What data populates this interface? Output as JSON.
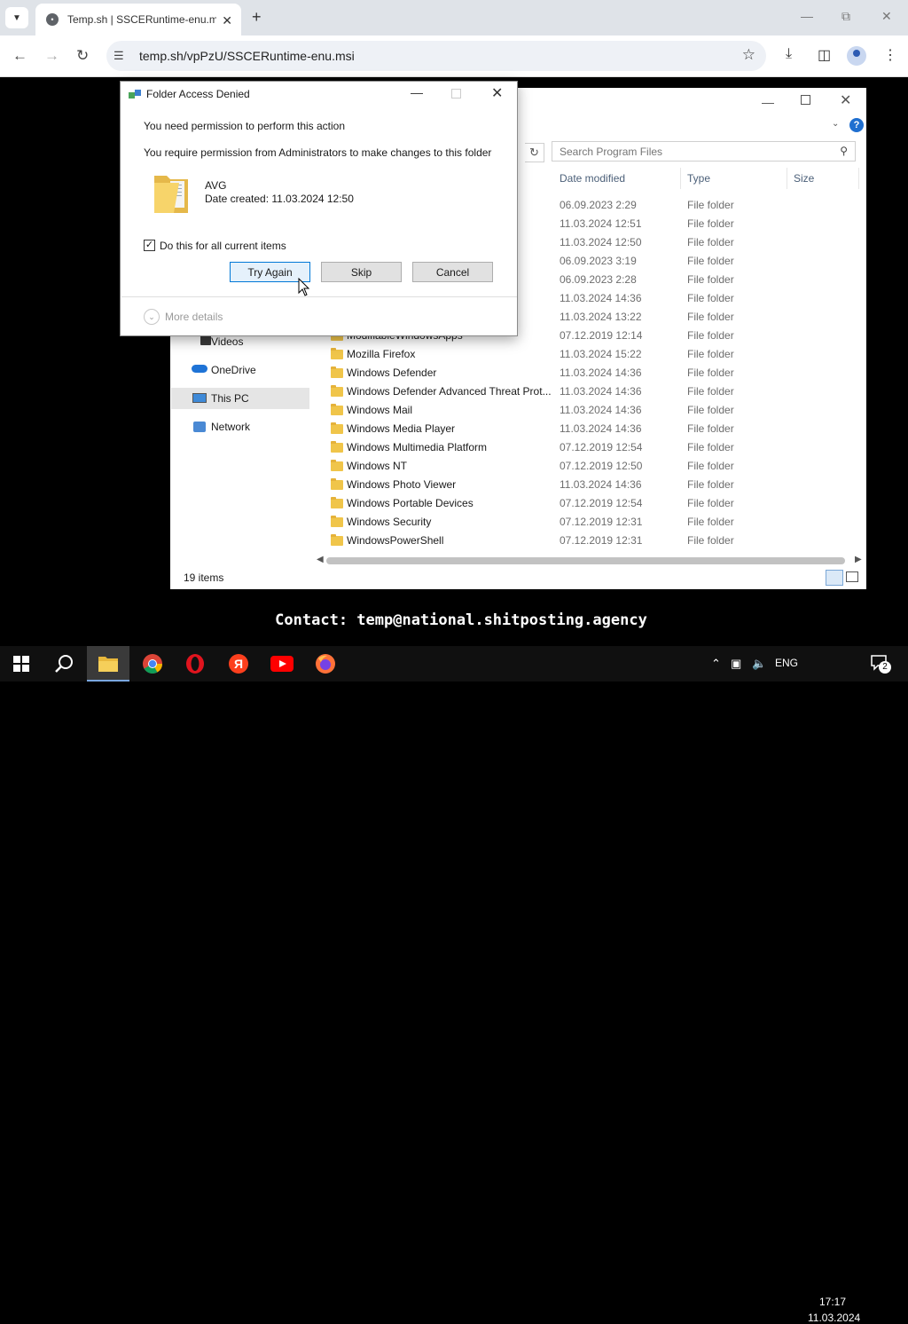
{
  "browser": {
    "tab_title": "Temp.sh | SSCERuntime-enu.msi",
    "url": "temp.sh/vpPzU/SSCERuntime-enu.msi"
  },
  "explorer": {
    "search_placeholder": "Search Program Files",
    "columns": {
      "date": "Date modified",
      "type": "Type",
      "size": "Size"
    },
    "rows": [
      {
        "name": "",
        "date": "06.09.2023 2:29",
        "type": "File folder"
      },
      {
        "name": "",
        "date": "11.03.2024 12:51",
        "type": "File folder"
      },
      {
        "name": "",
        "date": "11.03.2024 12:50",
        "type": "File folder"
      },
      {
        "name": "",
        "date": "06.09.2023 3:19",
        "type": "File folder"
      },
      {
        "name": "",
        "date": "06.09.2023 2:28",
        "type": "File folder"
      },
      {
        "name": "",
        "date": "11.03.2024 14:36",
        "type": "File folder"
      },
      {
        "name": "",
        "date": "11.03.2024 13:22",
        "type": "File folder"
      },
      {
        "name": "ModifiableWindowsApps",
        "date": "07.12.2019 12:14",
        "type": "File folder"
      },
      {
        "name": "Mozilla Firefox",
        "date": "11.03.2024 15:22",
        "type": "File folder"
      },
      {
        "name": "Windows Defender",
        "date": "11.03.2024 14:36",
        "type": "File folder"
      },
      {
        "name": "Windows Defender Advanced Threat Prot...",
        "date": "11.03.2024 14:36",
        "type": "File folder"
      },
      {
        "name": "Windows Mail",
        "date": "11.03.2024 14:36",
        "type": "File folder"
      },
      {
        "name": "Windows Media Player",
        "date": "11.03.2024 14:36",
        "type": "File folder"
      },
      {
        "name": "Windows Multimedia Platform",
        "date": "07.12.2019 12:54",
        "type": "File folder"
      },
      {
        "name": "Windows NT",
        "date": "07.12.2019 12:50",
        "type": "File folder"
      },
      {
        "name": "Windows Photo Viewer",
        "date": "11.03.2024 14:36",
        "type": "File folder"
      },
      {
        "name": "Windows Portable Devices",
        "date": "07.12.2019 12:54",
        "type": "File folder"
      },
      {
        "name": "Windows Security",
        "date": "07.12.2019 12:31",
        "type": "File folder"
      },
      {
        "name": "WindowsPowerShell",
        "date": "07.12.2019 12:31",
        "type": "File folder"
      }
    ],
    "nav": {
      "videos": "Videos",
      "onedrive": "OneDrive",
      "thispc": "This PC",
      "network": "Network"
    },
    "status": "19 items"
  },
  "dialog": {
    "title": "Folder Access Denied",
    "message1": "You need permission to perform this action",
    "message2": "You require permission from Administrators to make changes to this folder",
    "folder_name": "AVG",
    "folder_date": "Date created: 11.03.2024 12:50",
    "checkbox_label": "Do this for all current items",
    "checkbox_checked": true,
    "buttons": {
      "try_again": "Try Again",
      "skip": "Skip",
      "cancel": "Cancel"
    },
    "more_details": "More details"
  },
  "overlay": {
    "contact": "Contact: temp@national.shitposting.agency"
  },
  "taskbar": {
    "apps": [
      "start-icon",
      "search-icon",
      "file-explorer-icon",
      "chrome-icon",
      "opera-icon",
      "yandex-icon",
      "youtube-icon",
      "firefox-icon"
    ],
    "language": "ENG",
    "time": "17:17",
    "date": "11.03.2024",
    "notifications": "2"
  },
  "colors": {
    "accent": "#0078d7",
    "folder": "#f0c54a",
    "taskbar": "#101010"
  }
}
